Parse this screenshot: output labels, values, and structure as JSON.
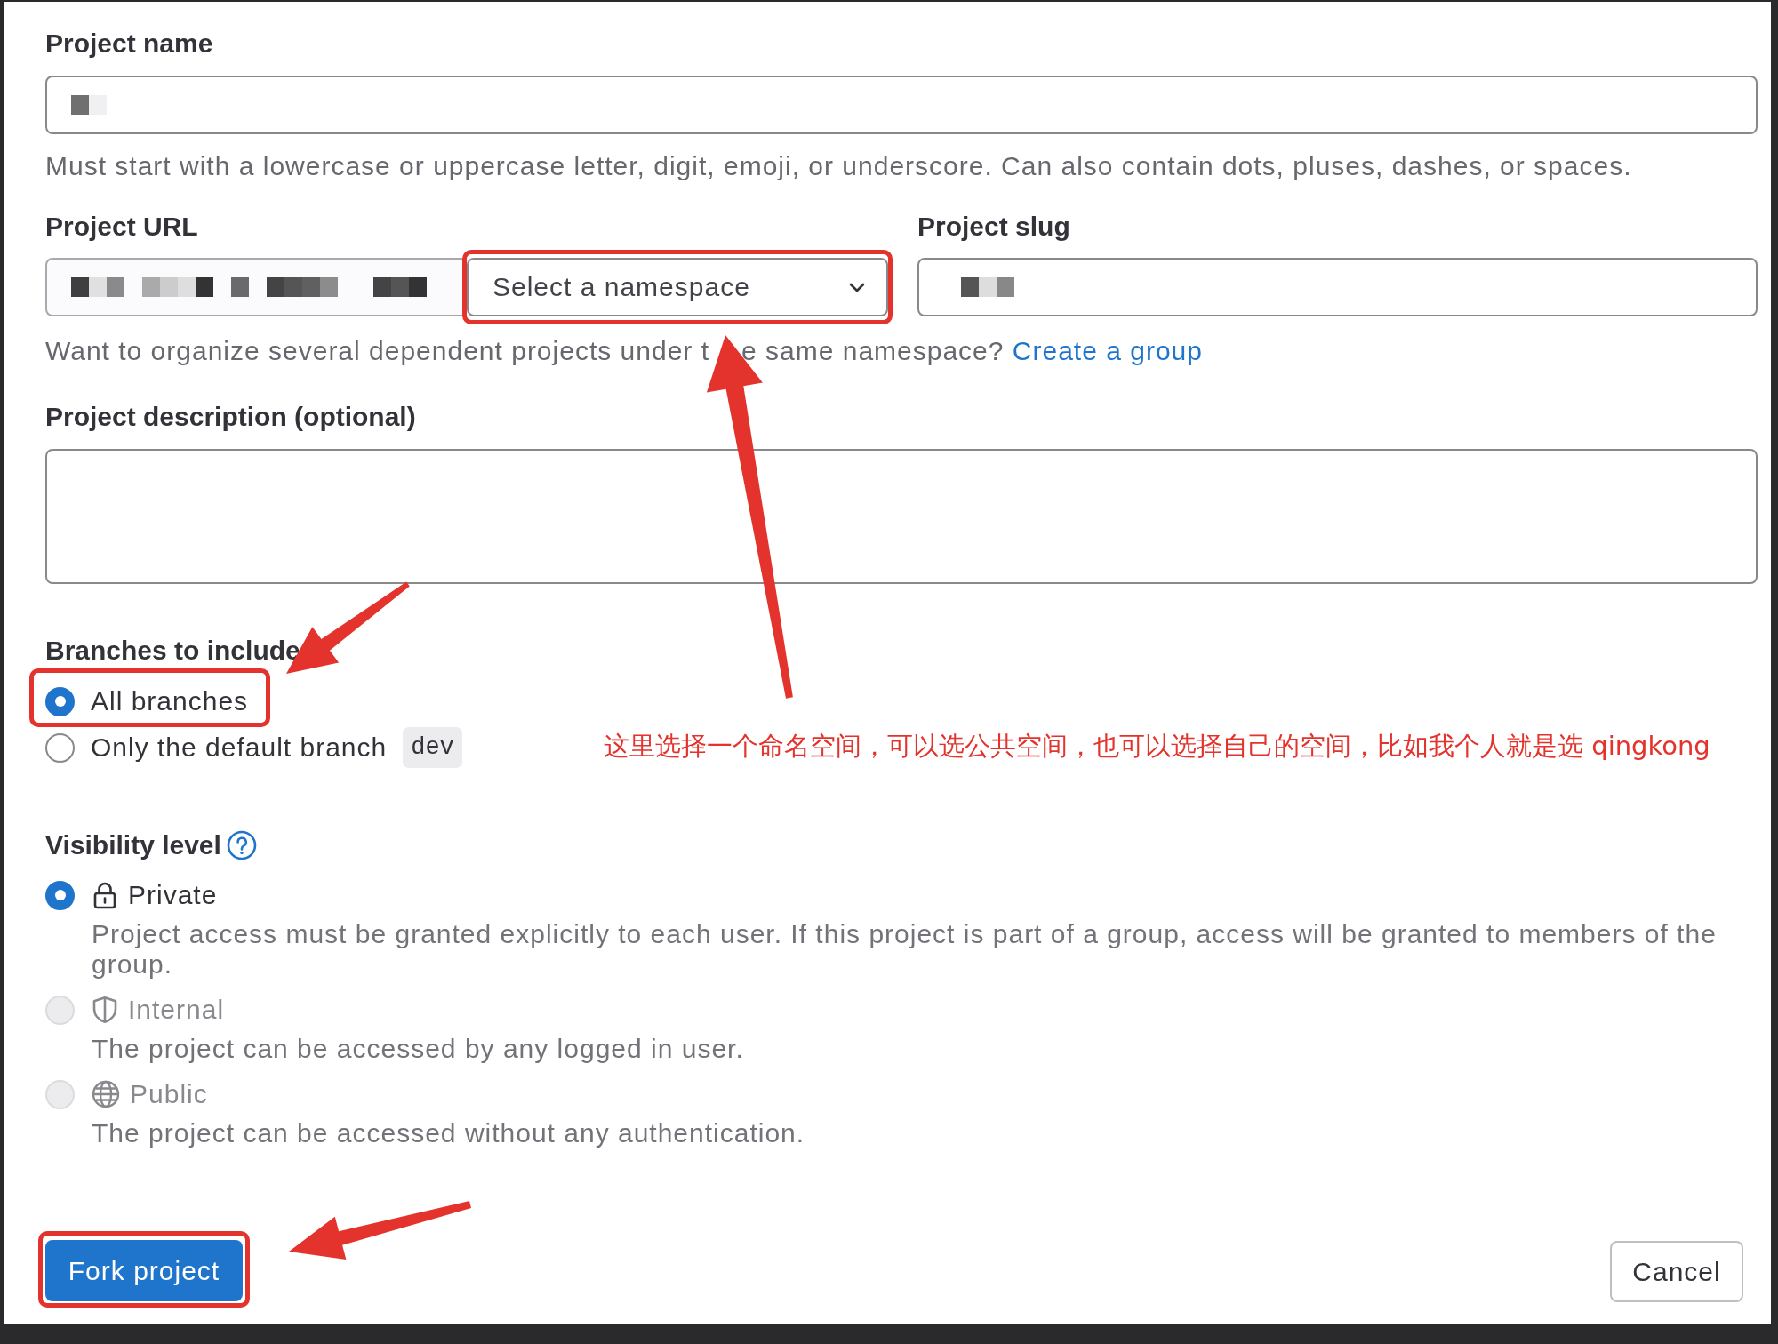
{
  "form": {
    "project_name": {
      "label": "Project name",
      "help": "Must start with a lowercase or uppercase letter, digit, emoji, or underscore. Can also contain dots, pluses, dashes, or spaces."
    },
    "project_url": {
      "label": "Project URL",
      "namespace_select": {
        "label": "Select a namespace",
        "highlighted": true
      },
      "help": [
        "Want to organize several dependent projects under t",
        "e same namespace?"
      ],
      "help_link": "Create a group"
    },
    "project_slug": {
      "label": "Project slug"
    },
    "description": {
      "label": "Project description (optional)"
    },
    "branches": {
      "label": "Branches to include",
      "options": [
        {
          "label": "All branches",
          "selected": true,
          "highlighted": true
        },
        {
          "label": "Only the default branch",
          "selected": false,
          "highlighted": false,
          "badge": "dev"
        }
      ]
    },
    "visibility": {
      "label": "Visibility level",
      "options": [
        {
          "kind": "private",
          "label": "Private",
          "description": "Project access must be granted explicitly to each user. If this project is part of a group, access will be granted to members of the group.",
          "selected": true,
          "disabled": false
        },
        {
          "kind": "internal",
          "label": "Internal",
          "description": "The project can be accessed by any logged in user.",
          "selected": false,
          "disabled": true
        },
        {
          "kind": "public",
          "label": "Public",
          "description": "The project can be accessed without any authentication.",
          "selected": false,
          "disabled": true
        }
      ]
    },
    "buttons": [
      {
        "kind": "primary",
        "label": "Fork project",
        "highlighted": true
      },
      {
        "kind": "secondary",
        "label": "Cancel",
        "highlighted": false
      }
    ]
  },
  "annotation": {
    "note": "这里选择一个命名空间，可以选公共空间，也可以选择自己的空间，比如我个人就是选 qingkong"
  }
}
